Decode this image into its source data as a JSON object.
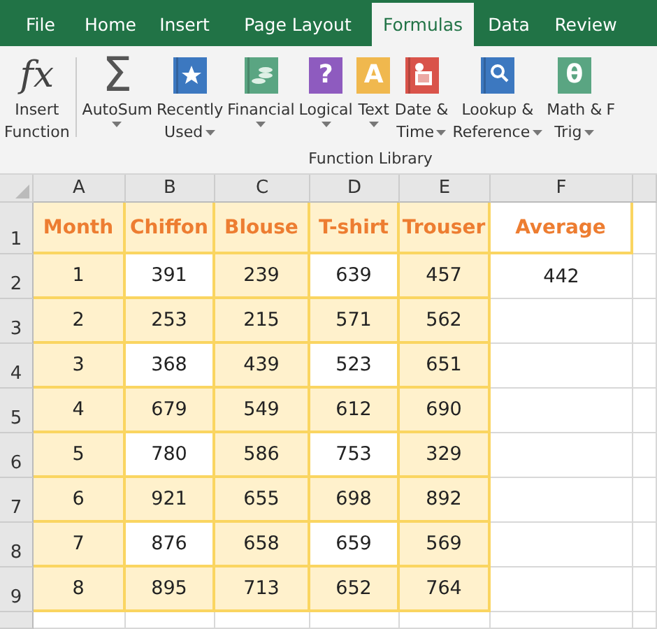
{
  "tabs": [
    {
      "label": "File",
      "selected": false
    },
    {
      "label": "Home",
      "selected": false
    },
    {
      "label": "Insert",
      "selected": false
    },
    {
      "label": "Page Layout",
      "selected": false
    },
    {
      "label": "Formulas",
      "selected": true
    },
    {
      "label": "Data",
      "selected": false
    },
    {
      "label": "Review",
      "selected": false
    }
  ],
  "ribbon": {
    "group_label": "Function Library",
    "buttons": [
      {
        "kind": "fx",
        "glyph": "fx",
        "lines": [
          "Insert",
          "Function"
        ],
        "dropdown": false
      },
      {
        "kind": "sigma",
        "glyph": "Σ",
        "lines": [
          "AutoSum"
        ],
        "dropdown": true
      },
      {
        "kind": "star",
        "color": "#3c78c0",
        "lines": [
          "Recently",
          "Used"
        ],
        "dropdown": true
      },
      {
        "kind": "coins",
        "color": "#5aa582",
        "lines": [
          "Financial"
        ],
        "dropdown": true
      },
      {
        "kind": "glyph",
        "color": "#8e5bbf",
        "glyph": "?",
        "lines": [
          "Logical"
        ],
        "dropdown": true
      },
      {
        "kind": "glyph",
        "color": "#f0b84e",
        "glyph": "A",
        "lines": [
          "Text"
        ],
        "dropdown": true
      },
      {
        "kind": "calendar",
        "color": "#d9534a",
        "lines": [
          "Date &",
          "Time"
        ],
        "dropdown": true
      },
      {
        "kind": "search",
        "color": "#3c78c0",
        "lines": [
          "Lookup &",
          "Reference"
        ],
        "dropdown": true
      },
      {
        "kind": "glyph",
        "color": "#5aa582",
        "glyph": "θ",
        "lines": [
          "Math &",
          "Trig"
        ],
        "dropdown": true
      },
      {
        "kind": "cut",
        "lines": [
          "F"
        ],
        "dropdown": false
      }
    ]
  },
  "sheet": {
    "columns": [
      "A",
      "B",
      "C",
      "D",
      "E",
      "F"
    ],
    "rows": [
      {
        "header": "1",
        "kind": "heading",
        "cells": [
          {
            "text": "Month",
            "shaded": true
          },
          {
            "text": "Chiffon",
            "shaded": true
          },
          {
            "text": "Blouse",
            "shaded": true
          },
          {
            "text": "T-shirt",
            "shaded": true
          },
          {
            "text": "Trouser",
            "shaded": true
          },
          {
            "text": "Average",
            "shaded": false
          }
        ]
      },
      {
        "header": "2",
        "kind": "data",
        "cells": [
          {
            "text": "1",
            "shaded": true
          },
          {
            "text": "391",
            "shaded": false
          },
          {
            "text": "239",
            "shaded": true
          },
          {
            "text": "639",
            "shaded": false
          },
          {
            "text": "457",
            "shaded": true
          },
          {
            "text": "442",
            "shaded": false
          }
        ]
      },
      {
        "header": "3",
        "kind": "data",
        "cells": [
          {
            "text": "2",
            "shaded": true
          },
          {
            "text": "253",
            "shaded": true
          },
          {
            "text": "215",
            "shaded": true
          },
          {
            "text": "571",
            "shaded": true
          },
          {
            "text": "562",
            "shaded": true
          }
        ]
      },
      {
        "header": "4",
        "kind": "data",
        "cells": [
          {
            "text": "3",
            "shaded": true
          },
          {
            "text": "368",
            "shaded": false
          },
          {
            "text": "439",
            "shaded": true
          },
          {
            "text": "523",
            "shaded": false
          },
          {
            "text": "651",
            "shaded": true
          }
        ]
      },
      {
        "header": "5",
        "kind": "data",
        "cells": [
          {
            "text": "4",
            "shaded": true
          },
          {
            "text": "679",
            "shaded": true
          },
          {
            "text": "549",
            "shaded": true
          },
          {
            "text": "612",
            "shaded": true
          },
          {
            "text": "690",
            "shaded": true
          }
        ]
      },
      {
        "header": "6",
        "kind": "data",
        "cells": [
          {
            "text": "5",
            "shaded": true
          },
          {
            "text": "780",
            "shaded": false
          },
          {
            "text": "586",
            "shaded": true
          },
          {
            "text": "753",
            "shaded": false
          },
          {
            "text": "329",
            "shaded": true
          }
        ]
      },
      {
        "header": "7",
        "kind": "data",
        "cells": [
          {
            "text": "6",
            "shaded": true
          },
          {
            "text": "921",
            "shaded": true
          },
          {
            "text": "655",
            "shaded": true
          },
          {
            "text": "698",
            "shaded": true
          },
          {
            "text": "892",
            "shaded": true
          }
        ]
      },
      {
        "header": "8",
        "kind": "data",
        "cells": [
          {
            "text": "7",
            "shaded": true
          },
          {
            "text": "876",
            "shaded": false
          },
          {
            "text": "658",
            "shaded": true
          },
          {
            "text": "659",
            "shaded": false
          },
          {
            "text": "569",
            "shaded": true
          }
        ]
      },
      {
        "header": "9",
        "kind": "data",
        "cells": [
          {
            "text": "8",
            "shaded": true
          },
          {
            "text": "895",
            "shaded": true
          },
          {
            "text": "713",
            "shaded": true
          },
          {
            "text": "652",
            "shaded": true
          },
          {
            "text": "764",
            "shaded": true
          }
        ]
      }
    ]
  }
}
